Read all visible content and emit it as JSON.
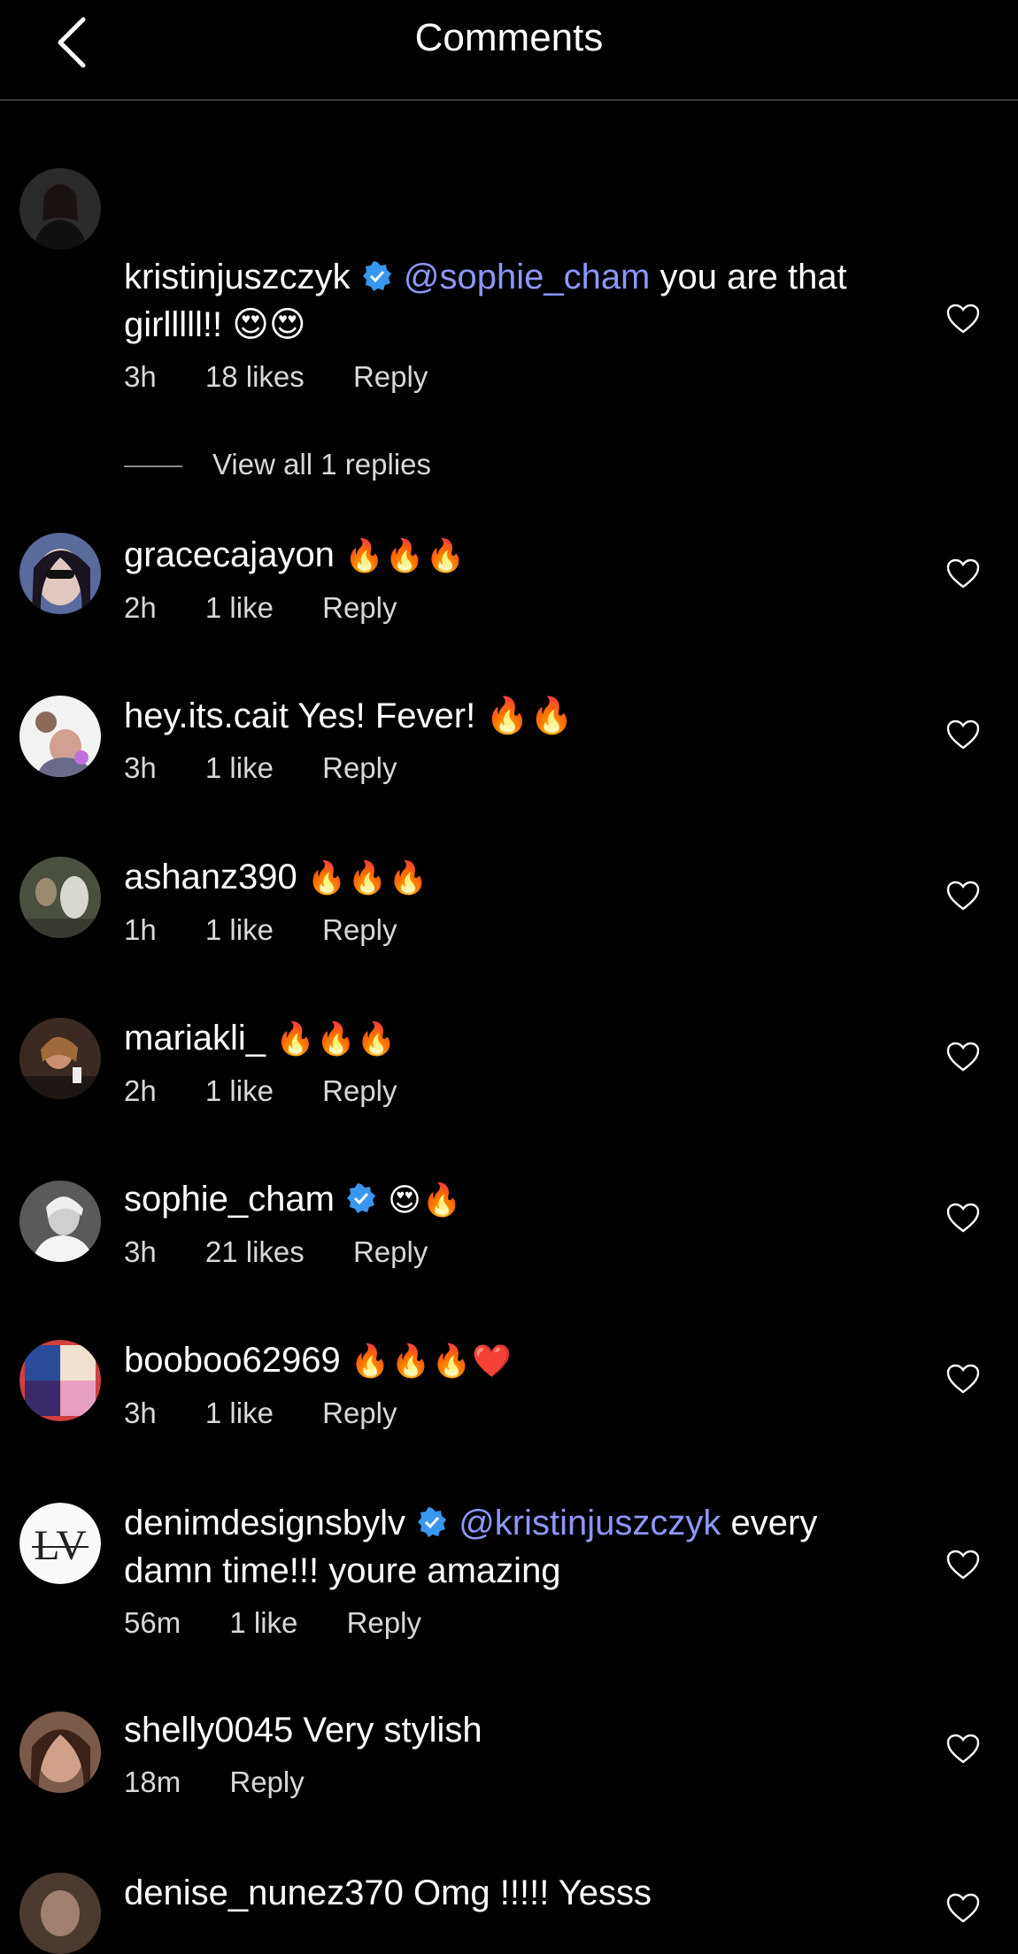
{
  "header": {
    "title": "Comments"
  },
  "icons": {
    "back": "chevron-left-icon",
    "heart": "heart-outline-icon",
    "verified": "verified-badge-icon"
  },
  "colors": {
    "mention": "#8e96f9",
    "verified": "#3897f0",
    "background": "#000000"
  },
  "view_replies": {
    "label": "View all 1 replies"
  },
  "comments": [
    {
      "user": "kristinjuszczyk",
      "verified": true,
      "mention": "@sophie_cham",
      "text": " you are that",
      "text2": "girlllll!! 😍😍",
      "time": "3h",
      "likes": "18 likes",
      "reply": "Reply"
    },
    {
      "user": "gracecajayon",
      "text": "🔥🔥🔥",
      "time": "2h",
      "likes": "1 like",
      "reply": "Reply"
    },
    {
      "user": "hey.its.cait",
      "text": "Yes! Fever! 🔥🔥",
      "time": "3h",
      "likes": "1 like",
      "reply": "Reply"
    },
    {
      "user": "ashanz390",
      "text": "🔥🔥🔥",
      "time": "1h",
      "likes": "1 like",
      "reply": "Reply"
    },
    {
      "user": "mariakli_",
      "text": "🔥🔥🔥",
      "time": "2h",
      "likes": "1 like",
      "reply": "Reply"
    },
    {
      "user": "sophie_cham",
      "verified": true,
      "text": "😍🔥",
      "time": "3h",
      "likes": "21 likes",
      "reply": "Reply"
    },
    {
      "user": "booboo62969",
      "text": "🔥🔥🔥❤️",
      "time": "3h",
      "likes": "1 like",
      "reply": "Reply"
    },
    {
      "user": "denimdesignsbylv",
      "verified": true,
      "mention": "@kristinjuszczyk",
      "text": " every",
      "text2": "damn time!!! youre amazing",
      "time": "56m",
      "likes": "1 like",
      "reply": "Reply"
    },
    {
      "user": "shelly0045",
      "text": "Very stylish",
      "time": "18m",
      "likes": "",
      "reply": "Reply"
    },
    {
      "user": "denise_nunez370",
      "text": "Omg !!!!! Yesss"
    }
  ]
}
